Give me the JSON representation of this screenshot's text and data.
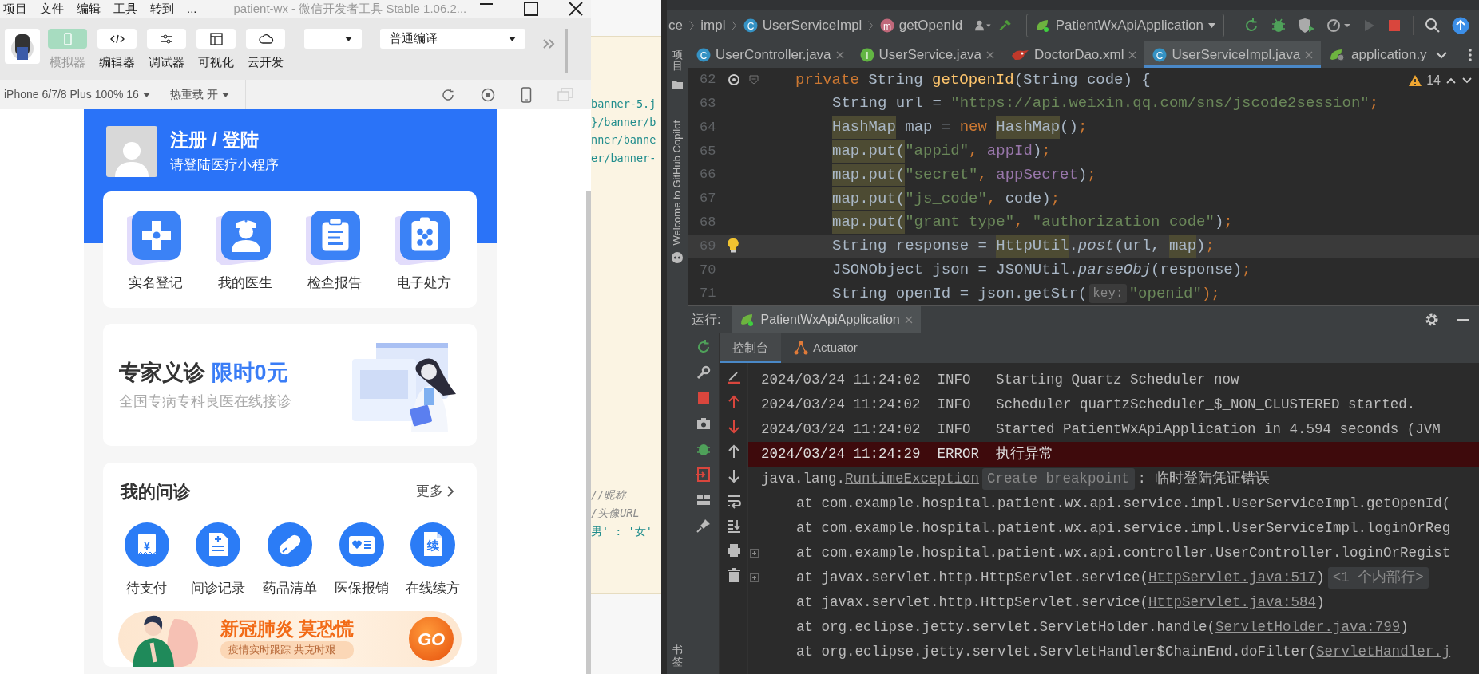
{
  "devtools": {
    "menu": [
      "项目",
      "文件",
      "编辑",
      "工具",
      "转到",
      "..."
    ],
    "title": "patient-wx  -  微信开发者工具 Stable 1.06.2...",
    "toolbar": [
      {
        "label": "模拟器",
        "kind": "simulator",
        "selected": true
      },
      {
        "label": "编辑器",
        "kind": "editor",
        "selected": false
      },
      {
        "label": "调试器",
        "kind": "debugger",
        "selected": false
      },
      {
        "label": "可视化",
        "kind": "visual",
        "selected": false
      },
      {
        "label": "云开发",
        "kind": "cloud",
        "selected": false
      }
    ],
    "compile_mode": "普通编译",
    "device": "iPhone 6/7/8 Plus 100% 16",
    "hot_reload": "热重载 开"
  },
  "phone": {
    "user": {
      "title": "注册 / 登陆",
      "subtitle": "请登陆医疗小程序"
    },
    "services": [
      {
        "label": "实名登记",
        "kind": "cross"
      },
      {
        "label": "我的医生",
        "kind": "doctor"
      },
      {
        "label": "检查报告",
        "kind": "report"
      },
      {
        "label": "电子处方",
        "kind": "prescription"
      }
    ],
    "promo": {
      "title": "专家义诊",
      "highlight": "限时0元",
      "subtitle": "全国专病专科良医在线接诊"
    },
    "consult": {
      "title": "我的问诊",
      "more": "更多",
      "items": [
        {
          "label": "待支付",
          "kind": "payment",
          "glyph": "¥"
        },
        {
          "label": "问诊记录",
          "kind": "record"
        },
        {
          "label": "药品清单",
          "kind": "medicine"
        },
        {
          "label": "医保报销",
          "kind": "insurance"
        },
        {
          "label": "在线续方",
          "kind": "renewal",
          "glyph": "续"
        }
      ]
    },
    "banner": {
      "title": "新冠肺炎 莫恐慌",
      "subtitle": "疫情实时跟踪 共克时艰",
      "button": "GO"
    }
  },
  "editor_peek": {
    "lines": [
      {
        "text": "banner-5.j",
        "kind": "string"
      },
      {
        "text": "}/banner/b",
        "kind": "string"
      },
      {
        "text": "nner/banne",
        "kind": "string"
      },
      {
        "text": "er/banner-",
        "kind": "string"
      }
    ],
    "lines_below": [
      {
        "text": "//昵称",
        "kind": "comment"
      },
      {
        "text": "/头像URL",
        "kind": "comment"
      },
      {
        "text": "男' : '女'",
        "kind": "string"
      }
    ]
  },
  "ide": {
    "breadcrumb": [
      {
        "label": "ce",
        "kind": "text"
      },
      {
        "label": "impl",
        "kind": "text"
      },
      {
        "label": "UserServiceImpl",
        "kind": "class",
        "badge": "C"
      },
      {
        "label": "getOpenId",
        "kind": "method",
        "badge": "m"
      }
    ],
    "run_config": "PatientWxApiApplication",
    "side_tabs": [
      "项目",
      "Welcome to GitHub Copilot"
    ],
    "tabs": [
      {
        "label": "UserController.java",
        "kind": "class",
        "badge": "C",
        "selected": false
      },
      {
        "label": "UserService.java",
        "kind": "interface",
        "badge": "I",
        "selected": false
      },
      {
        "label": "DoctorDao.xml",
        "kind": "xml",
        "selected": false
      },
      {
        "label": "UserServiceImpl.java",
        "kind": "class",
        "badge": "C",
        "selected": true
      },
      {
        "label": "application.y",
        "kind": "yaml",
        "selected": false
      }
    ],
    "warnings": "14",
    "code": [
      {
        "number": "62",
        "kind": "declaration",
        "current": false,
        "parts": [
          {
            "text": "private ",
            "kind": "keyword"
          },
          {
            "text": "String ",
            "kind": "plain"
          },
          {
            "text": "getOpenId",
            "kind": "method"
          },
          {
            "text": "(String code) {",
            "kind": "plain"
          }
        ]
      },
      {
        "number": "63",
        "kind": "statement",
        "current": false,
        "parts": [
          {
            "text": "String url = ",
            "kind": "plain"
          },
          {
            "text": "\"",
            "kind": "string"
          },
          {
            "text": "https://api.weixin.qq.com/sns/jscode2session",
            "kind": "url"
          },
          {
            "text": "\"",
            "kind": "string"
          },
          {
            "text": ";",
            "kind": "keyword"
          }
        ]
      },
      {
        "number": "64",
        "kind": "statement",
        "current": false,
        "parts": [
          {
            "text": "HashMap",
            "kind": "usage"
          },
          {
            "text": " map = ",
            "kind": "plain"
          },
          {
            "text": "new ",
            "kind": "keyword"
          },
          {
            "text": "HashMap",
            "kind": "usage"
          },
          {
            "text": "()",
            "kind": "plain"
          },
          {
            "text": ";",
            "kind": "keyword"
          }
        ]
      },
      {
        "number": "65",
        "kind": "statement",
        "current": false,
        "parts": [
          {
            "text": "map.put(",
            "kind": "usage"
          },
          {
            "text": "\"appid\"",
            "kind": "string"
          },
          {
            "text": ", ",
            "kind": "keyword"
          },
          {
            "text": "appId",
            "kind": "field"
          },
          {
            "text": ")",
            "kind": "plain"
          },
          {
            "text": ";",
            "kind": "keyword"
          }
        ]
      },
      {
        "number": "66",
        "kind": "statement",
        "current": false,
        "parts": [
          {
            "text": "map.put(",
            "kind": "usage"
          },
          {
            "text": "\"secret\"",
            "kind": "string"
          },
          {
            "text": ", ",
            "kind": "keyword"
          },
          {
            "text": "appSecret",
            "kind": "field"
          },
          {
            "text": ")",
            "kind": "plain"
          },
          {
            "text": ";",
            "kind": "keyword"
          }
        ]
      },
      {
        "number": "67",
        "kind": "statement",
        "current": false,
        "parts": [
          {
            "text": "map.put(",
            "kind": "usage"
          },
          {
            "text": "\"js_code\"",
            "kind": "string"
          },
          {
            "text": ", ",
            "kind": "keyword"
          },
          {
            "text": "code)",
            "kind": "plain"
          },
          {
            "text": ";",
            "kind": "keyword"
          }
        ]
      },
      {
        "number": "68",
        "kind": "statement",
        "current": false,
        "parts": [
          {
            "text": "map.put(",
            "kind": "usage"
          },
          {
            "text": "\"grant_type\"",
            "kind": "string"
          },
          {
            "text": ", ",
            "kind": "keyword"
          },
          {
            "text": "\"authorization_code\"",
            "kind": "string"
          },
          {
            "text": ")",
            "kind": "plain"
          },
          {
            "text": ";",
            "kind": "keyword"
          }
        ]
      },
      {
        "number": "69",
        "kind": "statement",
        "current": true,
        "parts": [
          {
            "text": "String response = ",
            "kind": "plain"
          },
          {
            "text": "HttpUtil",
            "kind": "usage"
          },
          {
            "text": ".",
            "kind": "plain"
          },
          {
            "text": "post",
            "kind": "italic"
          },
          {
            "text": "(url, ",
            "kind": "plain"
          },
          {
            "text": "map",
            "kind": "usage"
          },
          {
            "text": ")",
            "kind": "plain"
          },
          {
            "text": ";",
            "kind": "keyword"
          }
        ]
      },
      {
        "number": "70",
        "kind": "statement",
        "current": false,
        "parts": [
          {
            "text": "JSONObject json = JSONUtil.",
            "kind": "plain"
          },
          {
            "text": "parseObj",
            "kind": "italic"
          },
          {
            "text": "(response)",
            "kind": "plain"
          },
          {
            "text": ";",
            "kind": "keyword"
          }
        ]
      },
      {
        "number": "71",
        "kind": "statement",
        "current": false,
        "parts": [
          {
            "text": "String openId = json.getStr(",
            "kind": "plain"
          },
          {
            "text": "key:",
            "kind": "hint"
          },
          {
            "text": "\"openid\"",
            "kind": "string"
          },
          {
            "text": ");",
            "kind": "keyword"
          }
        ]
      }
    ],
    "run": {
      "label": "运行:",
      "config": "PatientWxApiApplication",
      "tabs": [
        {
          "label": "控制台",
          "selected": true
        },
        {
          "label": "Actuator",
          "selected": false
        }
      ],
      "bookmarks": "书签",
      "console": [
        {
          "kind": "log",
          "foldable": false,
          "parts": [
            {
              "text": "2024/03/24 11:24:02  INFO   Starting Quartz Scheduler now",
              "kind": "text"
            }
          ]
        },
        {
          "kind": "log",
          "foldable": false,
          "parts": [
            {
              "text": "2024/03/24 11:24:02  INFO   Scheduler quartzScheduler_$_NON_CLUSTERED started.",
              "kind": "text"
            }
          ]
        },
        {
          "kind": "log",
          "foldable": false,
          "parts": [
            {
              "text": "2024/03/24 11:24:02  INFO   Started PatientWxApiApplication in 4.594 seconds (JVM",
              "kind": "text"
            }
          ]
        },
        {
          "kind": "error",
          "foldable": false,
          "parts": [
            {
              "text": "2024/03/24 11:24:29  ERROR  执行异常",
              "kind": "text"
            }
          ]
        },
        {
          "kind": "log",
          "foldable": false,
          "parts": [
            {
              "text": "java.lang.",
              "kind": "text"
            },
            {
              "text": "RuntimeException",
              "kind": "link"
            },
            {
              "text": "Create breakpoint",
              "kind": "hint"
            },
            {
              "text": ": 临时登陆凭证错误",
              "kind": "text"
            }
          ]
        },
        {
          "kind": "trace",
          "foldable": false,
          "parts": [
            {
              "text": "at com.example.hospital.patient.wx.api.service.impl.UserServiceImpl.getOpenId(",
              "kind": "text"
            }
          ]
        },
        {
          "kind": "trace",
          "foldable": false,
          "parts": [
            {
              "text": "at com.example.hospital.patient.wx.api.service.impl.UserServiceImpl.loginOrReg",
              "kind": "text"
            }
          ]
        },
        {
          "kind": "trace",
          "foldable": true,
          "parts": [
            {
              "text": "at com.example.hospital.patient.wx.api.controller.UserController.loginOrRegist",
              "kind": "text"
            }
          ]
        },
        {
          "kind": "trace",
          "foldable": true,
          "parts": [
            {
              "text": "at javax.servlet.http.HttpServlet.service(",
              "kind": "text"
            },
            {
              "text": "HttpServlet.java:517",
              "kind": "link"
            },
            {
              "text": ")",
              "kind": "text"
            },
            {
              "text": "<1 个内部行>",
              "kind": "hint"
            }
          ]
        },
        {
          "kind": "trace",
          "foldable": false,
          "parts": [
            {
              "text": "at javax.servlet.http.HttpServlet.service(",
              "kind": "text"
            },
            {
              "text": "HttpServlet.java:584",
              "kind": "link"
            },
            {
              "text": ")",
              "kind": "text"
            }
          ]
        },
        {
          "kind": "trace",
          "foldable": false,
          "parts": [
            {
              "text": "at org.eclipse.jetty.servlet.ServletHolder.handle(",
              "kind": "text"
            },
            {
              "text": "ServletHolder.java:799",
              "kind": "link"
            },
            {
              "text": ")",
              "kind": "text"
            }
          ]
        },
        {
          "kind": "trace",
          "foldable": false,
          "parts": [
            {
              "text": "at org.eclipse.jetty.servlet.ServletHandler$ChainEnd.doFilter(",
              "kind": "text"
            },
            {
              "text": "ServletHandler.j",
              "kind": "link"
            }
          ]
        }
      ]
    }
  }
}
